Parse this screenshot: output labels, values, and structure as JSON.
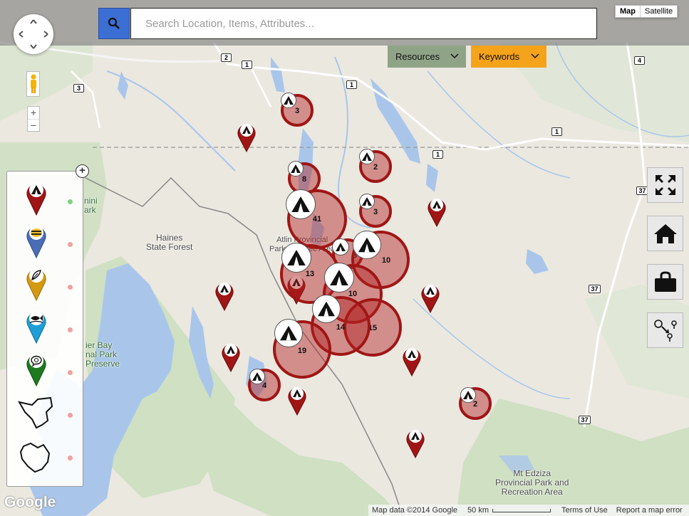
{
  "search": {
    "placeholder": "Search Location, Items, Attributes..."
  },
  "map_type": {
    "map_label": "Map",
    "satellite_label": "Satellite",
    "selected": "Map"
  },
  "filters": {
    "resources_label": "Resources",
    "keywords_label": "Keywords"
  },
  "zoom": {
    "in_label": "+",
    "out_label": "−"
  },
  "legend": {
    "add_label": "+",
    "items": [
      {
        "icon": "campsite-icon",
        "color": "#a01515",
        "status": "active",
        "status_color": "#7fd17f"
      },
      {
        "icon": "bee-icon",
        "color": "#4a6db5",
        "status": "inactive",
        "status_color": "#f2a0a0"
      },
      {
        "icon": "feather-icon",
        "color": "#d49a10",
        "status": "inactive",
        "status_color": "#f2a0a0"
      },
      {
        "icon": "fish-icon",
        "color": "#1e9ed6",
        "status": "inactive",
        "status_color": "#f2a0a0"
      },
      {
        "icon": "chat-icon",
        "color": "#1e7a1e",
        "status": "inactive",
        "status_color": "#f2a0a0"
      },
      {
        "icon": "region-outline-icon",
        "color": "#000000",
        "status": "inactive",
        "status_color": "#f2a0a0"
      },
      {
        "icon": "area-outline-icon",
        "color": "#000000",
        "status": "inactive",
        "status_color": "#f2a0a0"
      }
    ]
  },
  "tools": [
    "fullscreen-icon",
    "home-icon",
    "lock-icon",
    "route-icon"
  ],
  "map_labels": {
    "haines": "Haines\nState Forest",
    "atlin": "Atlin Provincial\nPark and Rec Area",
    "glacier": "ier Bay\nnal Park\nPreserve",
    "mini": "nini\nark",
    "edziza": "Mt Edziza\nProvincial Park and\nRecreation Area"
  },
  "road_shields": [
    "2",
    "1",
    "1",
    "3",
    "1",
    "1",
    "4",
    "37",
    "37",
    "37"
  ],
  "clusters": [
    3,
    2,
    8,
    41,
    3,
    8,
    10,
    13,
    10,
    14,
    15,
    19,
    4,
    2
  ],
  "footer": {
    "logo": "Google",
    "attribution": "Map data ©2014 Google",
    "scale": "50 km",
    "terms": "Terms of Use",
    "report": "Report a map error"
  },
  "colors": {
    "marker_red": "#a01515",
    "search_blue": "#3b6fd4",
    "resources_green": "#8fa486",
    "keywords_orange": "#f5a31b"
  }
}
